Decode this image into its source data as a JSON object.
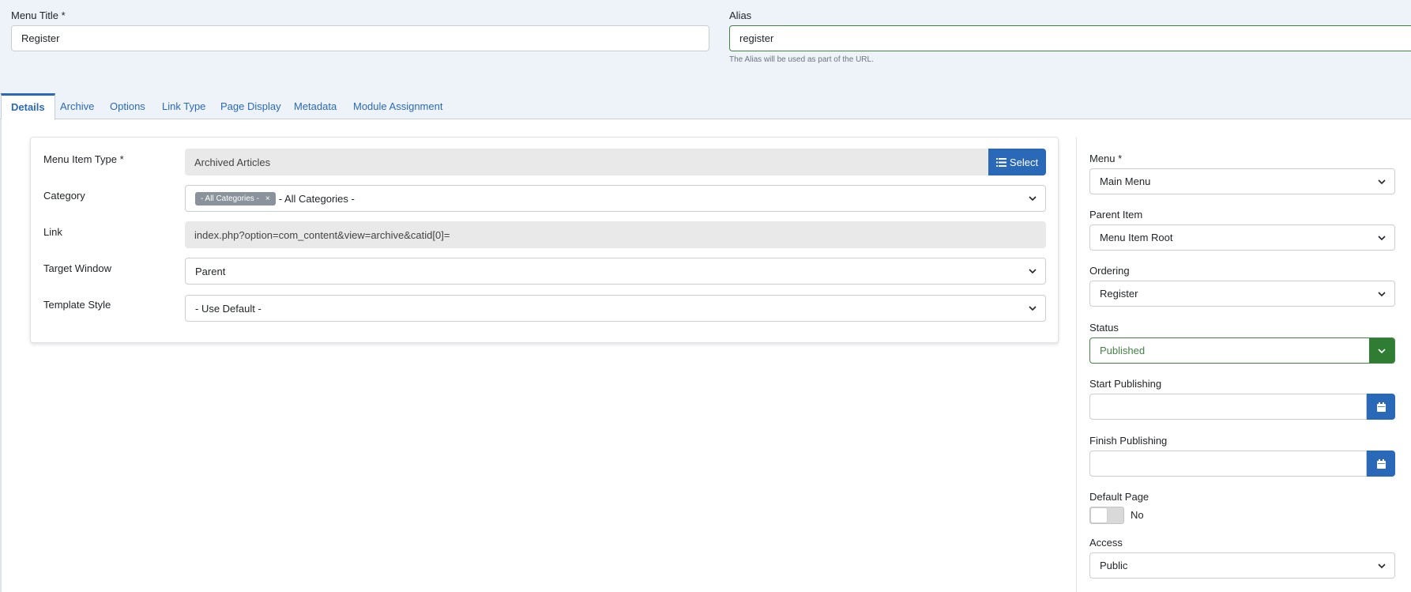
{
  "header": {
    "menu_title_label": "Menu Title *",
    "menu_title_value": "Register",
    "alias_label": "Alias",
    "alias_value": "register",
    "alias_hint": "The Alias will be used as part of the URL."
  },
  "tabs": [
    {
      "label": "Details"
    },
    {
      "label": "Archive"
    },
    {
      "label": "Options"
    },
    {
      "label": "Link Type"
    },
    {
      "label": "Page Display"
    },
    {
      "label": "Metadata"
    },
    {
      "label": "Module Assignment"
    }
  ],
  "details": {
    "menu_item_type_label": "Menu Item Type *",
    "menu_item_type_value": "Archived Articles",
    "select_label": "Select",
    "category_label": "Category",
    "category_chip": "- All Categories -",
    "category_chip_remove": "×",
    "category_value": "- All Categories -",
    "link_label": "Link",
    "link_value": "index.php?option=com_content&view=archive&catid[0]=",
    "target_window_label": "Target Window",
    "target_window_value": "Parent",
    "template_style_label": "Template Style",
    "template_style_value": "- Use Default -"
  },
  "sidebar": {
    "menu_label": "Menu *",
    "menu_value": "Main Menu",
    "parent_item_label": "Parent Item",
    "parent_item_value": "Menu Item Root",
    "ordering_label": "Ordering",
    "ordering_value": "Register",
    "status_label": "Status",
    "status_value": "Published",
    "start_publishing_label": "Start Publishing",
    "finish_publishing_label": "Finish Publishing",
    "default_page_label": "Default Page",
    "default_page_value": "No",
    "access_label": "Access",
    "access_value": "Public"
  },
  "colors": {
    "primary": "#2a69b8",
    "success": "#448344",
    "readonly_bg": "#e9e9e9"
  }
}
